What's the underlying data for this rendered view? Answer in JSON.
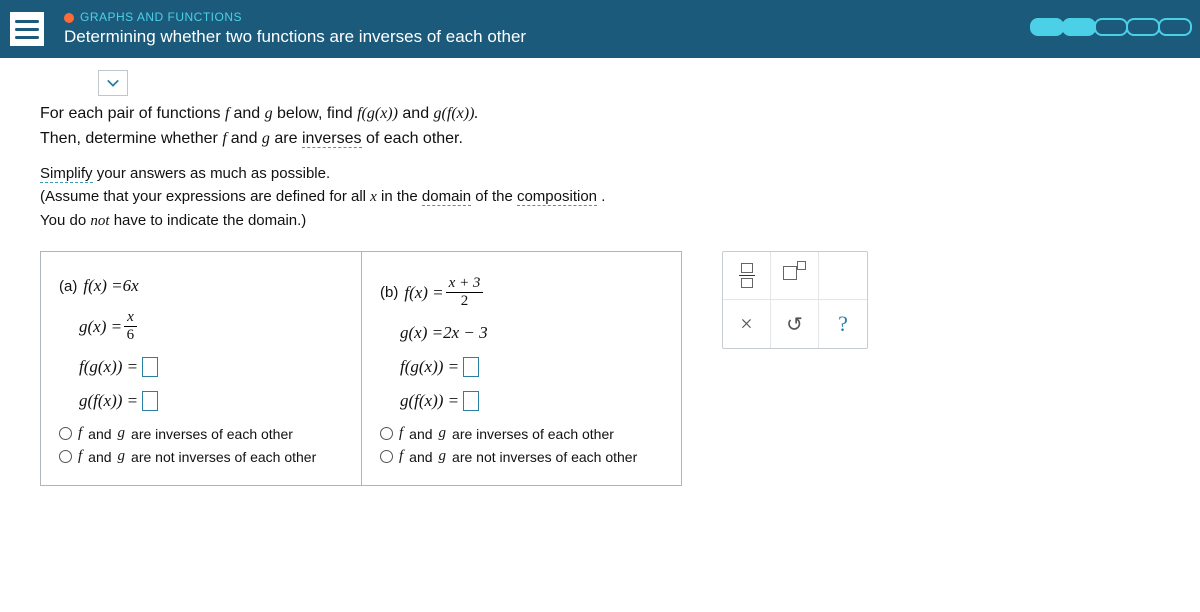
{
  "header": {
    "category": "GRAPHS AND FUNCTIONS",
    "topic": "Determining whether two functions are inverses of each other"
  },
  "instructions": {
    "line1_pre": "For each pair of functions ",
    "line1_mid": " below, find ",
    "comp_fg": "f(g(x))",
    "and1": " and ",
    "comp_gf": "g(f(x)).",
    "line2_pre": "Then, determine whether ",
    "f_and_g": "f and g",
    "line2_post": " are ",
    "inverses": "inverses",
    "line2_end": " of each other.",
    "line3_link": "Simplify",
    "line3_rest": " your answers as much as possible.",
    "line4_pre": "(Assume that your expressions are defined for all ",
    "x": "x",
    "line4_mid": " in the ",
    "domain": "domain",
    "of_the": " of the ",
    "composition": "composition",
    "line4_end": ".",
    "line5": "You do ",
    "not": "not",
    "line5_end": " have to indicate the domain.)"
  },
  "problem": {
    "a": {
      "label": "(a)",
      "f_lhs": "f(x) = ",
      "f_rhs": "6x",
      "g_lhs": "g(x) = ",
      "g_num": "x",
      "g_den": "6",
      "fgx": "f(g(x)) = ",
      "gfx": "g(f(x)) = "
    },
    "b": {
      "label": "(b)",
      "f_lhs": "f(x) = ",
      "f_num": "x + 3",
      "f_den": "2",
      "g_lhs": "g(x) = ",
      "g_rhs": "2x − 3",
      "fgx": "f(g(x)) = ",
      "gfx": "g(f(x)) = "
    },
    "radio_yes_pre": "f ",
    "radio_yes_mid": "and ",
    "radio_yes_g": "g ",
    "radio_yes_post": "are inverses of each other",
    "radio_no_post": "are not inverses of each other"
  },
  "toolbox": {
    "clear": "×",
    "reset": "↺",
    "help": "?"
  }
}
